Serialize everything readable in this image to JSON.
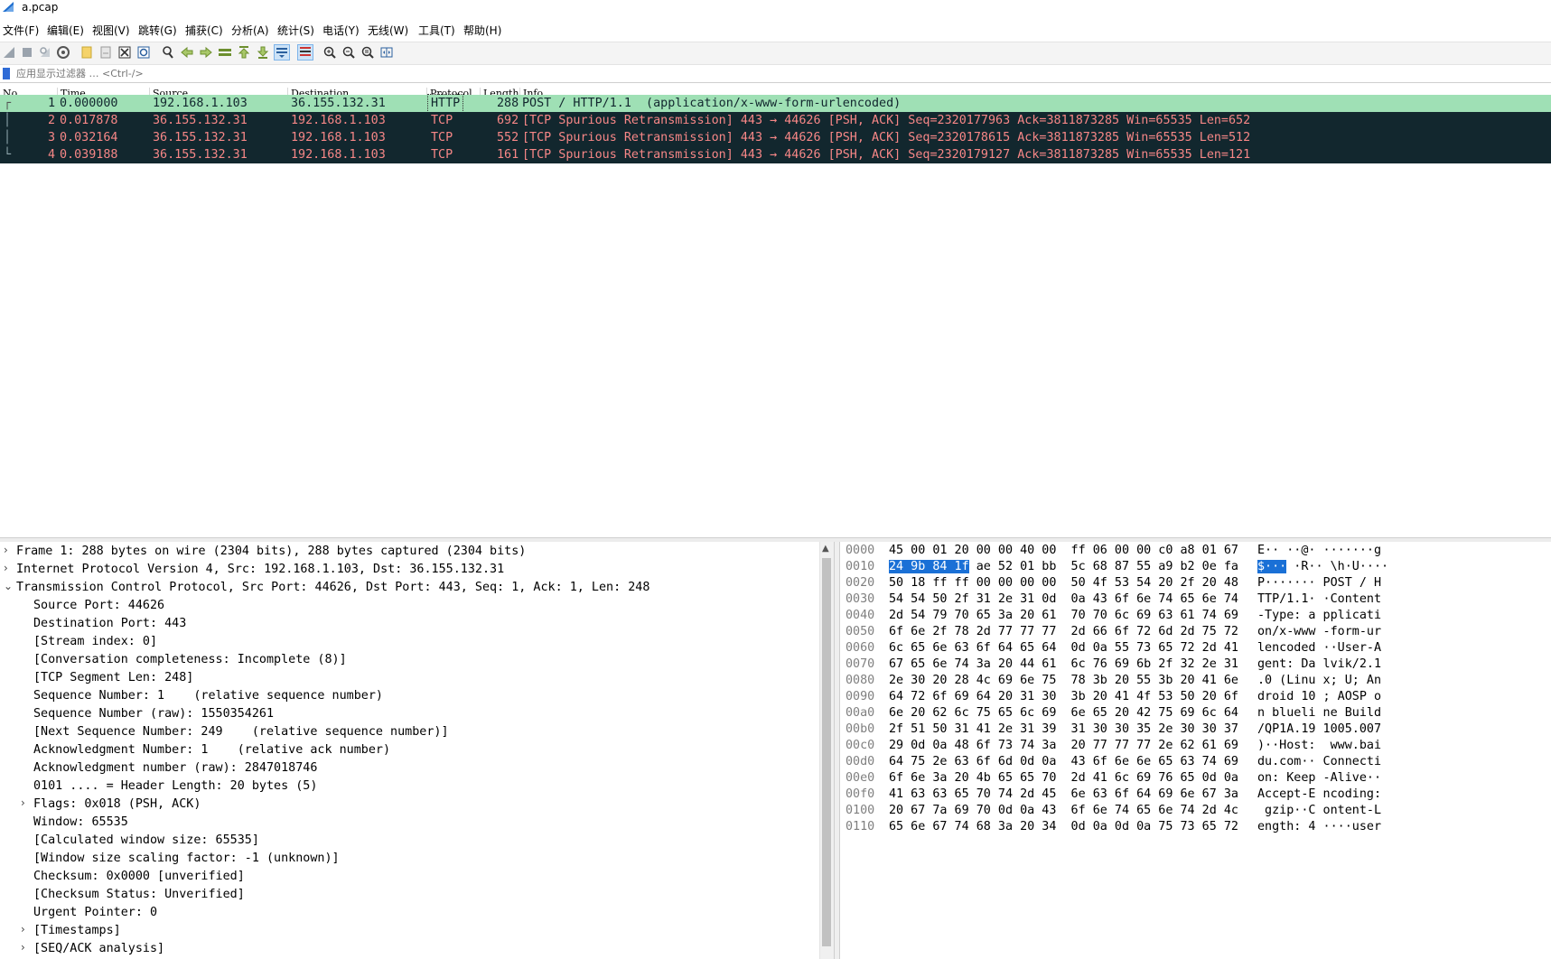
{
  "window": {
    "title": "a.pcap"
  },
  "menu": [
    {
      "id": "file",
      "label": "文件(F)"
    },
    {
      "id": "edit",
      "label": "编辑(E)"
    },
    {
      "id": "view",
      "label": "视图(V)"
    },
    {
      "id": "go",
      "label": "跳转(G)"
    },
    {
      "id": "capture",
      "label": "捕获(C)"
    },
    {
      "id": "analyze",
      "label": "分析(A)"
    },
    {
      "id": "statistics",
      "label": "统计(S)"
    },
    {
      "id": "telephony",
      "label": "电话(Y)"
    },
    {
      "id": "wireless",
      "label": "无线(W)"
    },
    {
      "id": "tools",
      "label": "工具(T)"
    },
    {
      "id": "help",
      "label": "帮助(H)"
    }
  ],
  "toolbar": {
    "icons": [
      "start-capture-icon",
      "stop-capture-icon",
      "restart-capture-icon",
      "capture-options-icon",
      "open-file-icon",
      "save-file-icon",
      "close-file-icon",
      "reload-file-icon",
      "find-packet-icon",
      "go-back-icon",
      "go-forward-icon",
      "go-to-packet-icon",
      "go-first-packet-icon",
      "go-last-packet-icon",
      "auto-scroll-icon",
      "colorize-icon",
      "zoom-in-icon",
      "zoom-out-icon",
      "normal-size-icon",
      "resize-columns-icon"
    ]
  },
  "filter": {
    "placeholder": "应用显示过滤器 … <Ctrl-/>"
  },
  "packet_list": {
    "columns": [
      "No.",
      "Time",
      "Source",
      "Destination",
      "Protocol",
      "Length",
      "Info"
    ],
    "rows": [
      {
        "no": "1",
        "time": "0.000000",
        "src": "192.168.1.103",
        "dst": "36.155.132.31",
        "proto": "HTTP",
        "len": "288",
        "info": "POST / HTTP/1.1  (application/x-www-form-urlencoded)",
        "style": "selected"
      },
      {
        "no": "2",
        "time": "0.017878",
        "src": "36.155.132.31",
        "dst": "192.168.1.103",
        "proto": "TCP",
        "len": "692",
        "info": "[TCP Spurious Retransmission] 443 → 44626 [PSH, ACK] Seq=2320177963 Ack=3811873285 Win=65535 Len=652",
        "style": "bad"
      },
      {
        "no": "3",
        "time": "0.032164",
        "src": "36.155.132.31",
        "dst": "192.168.1.103",
        "proto": "TCP",
        "len": "552",
        "info": "[TCP Spurious Retransmission] 443 → 44626 [PSH, ACK] Seq=2320178615 Ack=3811873285 Win=65535 Len=512",
        "style": "bad"
      },
      {
        "no": "4",
        "time": "0.039188",
        "src": "36.155.132.31",
        "dst": "192.168.1.103",
        "proto": "TCP",
        "len": "161",
        "info": "[TCP Spurious Retransmission] 443 → 44626 [PSH, ACK] Seq=2320179127 Ack=3811873285 Win=65535 Len=121",
        "style": "bad"
      }
    ]
  },
  "details": [
    {
      "arrow": "›",
      "text": "Frame 1: 288 bytes on wire (2304 bits), 288 bytes captured (2304 bits)",
      "indent": 0
    },
    {
      "arrow": "›",
      "text": "Internet Protocol Version 4, Src: 192.168.1.103, Dst: 36.155.132.31",
      "indent": 0
    },
    {
      "arrow": "⌄",
      "text": "Transmission Control Protocol, Src Port: 44626, Dst Port: 443, Seq: 1, Ack: 1, Len: 248",
      "indent": 0
    },
    {
      "arrow": "",
      "text": "Source Port: 44626",
      "indent": 1
    },
    {
      "arrow": "",
      "text": "Destination Port: 443",
      "indent": 1
    },
    {
      "arrow": "",
      "text": "[Stream index: 0]",
      "indent": 1
    },
    {
      "arrow": "",
      "text": "[Conversation completeness: Incomplete (8)]",
      "indent": 1
    },
    {
      "arrow": "",
      "text": "[TCP Segment Len: 248]",
      "indent": 1
    },
    {
      "arrow": "",
      "text": "Sequence Number: 1    (relative sequence number)",
      "indent": 1
    },
    {
      "arrow": "",
      "text": "Sequence Number (raw): 1550354261",
      "indent": 1
    },
    {
      "arrow": "",
      "text": "[Next Sequence Number: 249    (relative sequence number)]",
      "indent": 1
    },
    {
      "arrow": "",
      "text": "Acknowledgment Number: 1    (relative ack number)",
      "indent": 1
    },
    {
      "arrow": "",
      "text": "Acknowledgment number (raw): 2847018746",
      "indent": 1
    },
    {
      "arrow": "",
      "text": "0101 .... = Header Length: 20 bytes (5)",
      "indent": 1
    },
    {
      "arrow": "›",
      "text": "Flags: 0x018 (PSH, ACK)",
      "indent": 1
    },
    {
      "arrow": "",
      "text": "Window: 65535",
      "indent": 1
    },
    {
      "arrow": "",
      "text": "[Calculated window size: 65535]",
      "indent": 1
    },
    {
      "arrow": "",
      "text": "[Window size scaling factor: -1 (unknown)]",
      "indent": 1
    },
    {
      "arrow": "",
      "text": "Checksum: 0x0000 [unverified]",
      "indent": 1
    },
    {
      "arrow": "",
      "text": "[Checksum Status: Unverified]",
      "indent": 1
    },
    {
      "arrow": "",
      "text": "Urgent Pointer: 0",
      "indent": 1
    },
    {
      "arrow": "›",
      "text": "[Timestamps]",
      "indent": 1
    },
    {
      "arrow": "›",
      "text": "[SEQ/ACK analysis]",
      "indent": 1
    }
  ],
  "bytes": [
    {
      "off": "0000",
      "hex": "45 00 01 20 00 00 40 00  ff 06 00 00 c0 a8 01 67",
      "asc": "E·· ··@· ·······g"
    },
    {
      "off": "0010",
      "hex": "24 9b 84 1f ae 52 01 bb  5c 68 87 55 a9 b2 0e fa",
      "asc": "$··· ·R·· \\h·U····",
      "hl_hex": "24 9b 84 1f",
      "hl_asc": "$···"
    },
    {
      "off": "0020",
      "hex": "50 18 ff ff 00 00 00 00  50 4f 53 54 20 2f 20 48",
      "asc": "P······· POST / H"
    },
    {
      "off": "0030",
      "hex": "54 54 50 2f 31 2e 31 0d  0a 43 6f 6e 74 65 6e 74",
      "asc": "TTP/1.1· ·Content"
    },
    {
      "off": "0040",
      "hex": "2d 54 79 70 65 3a 20 61  70 70 6c 69 63 61 74 69",
      "asc": "-Type: a pplicati"
    },
    {
      "off": "0050",
      "hex": "6f 6e 2f 78 2d 77 77 77  2d 66 6f 72 6d 2d 75 72",
      "asc": "on/x-www -form-ur"
    },
    {
      "off": "0060",
      "hex": "6c 65 6e 63 6f 64 65 64  0d 0a 55 73 65 72 2d 41",
      "asc": "lencoded ··User-A"
    },
    {
      "off": "0070",
      "hex": "67 65 6e 74 3a 20 44 61  6c 76 69 6b 2f 32 2e 31",
      "asc": "gent: Da lvik/2.1"
    },
    {
      "off": "0080",
      "hex": "2e 30 20 28 4c 69 6e 75  78 3b 20 55 3b 20 41 6e",
      "asc": ".0 (Linu x; U; An"
    },
    {
      "off": "0090",
      "hex": "64 72 6f 69 64 20 31 30  3b 20 41 4f 53 50 20 6f",
      "asc": "droid 10 ; AOSP o"
    },
    {
      "off": "00a0",
      "hex": "6e 20 62 6c 75 65 6c 69  6e 65 20 42 75 69 6c 64",
      "asc": "n blueli ne Build"
    },
    {
      "off": "00b0",
      "hex": "2f 51 50 31 41 2e 31 39  31 30 30 35 2e 30 30 37",
      "asc": "/QP1A.19 1005.007"
    },
    {
      "off": "00c0",
      "hex": "29 0d 0a 48 6f 73 74 3a  20 77 77 77 2e 62 61 69",
      "asc": ")··Host:  www.bai"
    },
    {
      "off": "00d0",
      "hex": "64 75 2e 63 6f 6d 0d 0a  43 6f 6e 6e 65 63 74 69",
      "asc": "du.com·· Connecti"
    },
    {
      "off": "00e0",
      "hex": "6f 6e 3a 20 4b 65 65 70  2d 41 6c 69 76 65 0d 0a",
      "asc": "on: Keep -Alive··"
    },
    {
      "off": "00f0",
      "hex": "41 63 63 65 70 74 2d 45  6e 63 6f 64 69 6e 67 3a",
      "asc": "Accept-E ncoding:"
    },
    {
      "off": "0100",
      "hex": "20 67 7a 69 70 0d 0a 43  6f 6e 74 65 6e 74 2d 4c",
      "asc": " gzip··C ontent-L"
    },
    {
      "off": "0110",
      "hex": "65 6e 67 74 68 3a 20 34  0d 0a 0d 0a 75 73 65 72",
      "asc": "ength: 4 ····user"
    }
  ],
  "colors": {
    "selected_row_bg": "#9fe0b5",
    "bad_row_bg": "#12272e",
    "bad_row_fg": "#f78787",
    "byte_highlight": "#1a70d6"
  }
}
